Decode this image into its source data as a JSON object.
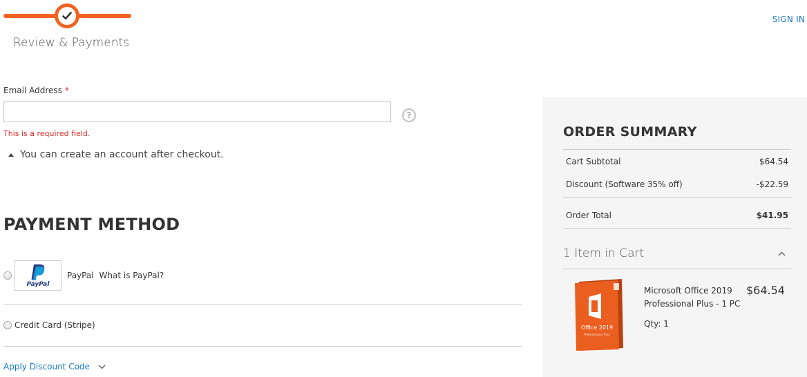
{
  "progress": {
    "step_title": "Review & Payments"
  },
  "header": {
    "sign_in": "SIGN IN"
  },
  "email": {
    "label": "Email Address",
    "required_mark": "*",
    "value": "",
    "error": "This is a required field.",
    "account_note": "You can create an account after checkout."
  },
  "payment": {
    "title": "PAYMENT METHOD",
    "methods": [
      {
        "label": "PayPal",
        "link": "What is PayPal?",
        "logo_text": "PayPal"
      },
      {
        "label": "Credit Card (Stripe)"
      }
    ],
    "discount_link": "Apply Discount Code"
  },
  "summary": {
    "title": "ORDER SUMMARY",
    "rows": [
      {
        "label": "Cart Subtotal",
        "value": "$64.54"
      },
      {
        "label": "Discount (Software 35% off)",
        "value": "-$22.59"
      },
      {
        "label": "Order Total",
        "value": "$41.95"
      }
    ],
    "cart_count": "1 Item in Cart",
    "item": {
      "name": "Microsoft Office 2019 Professional Plus - 1 PC",
      "price": "$64.54",
      "qty": "Qty: 1",
      "box_text": "Office 2019",
      "box_subtext": "Professional Plus"
    }
  },
  "colors": {
    "accent": "#f26322",
    "link": "#1979c3",
    "error": "#e02b27",
    "summary_bg": "#f5f5f5"
  }
}
